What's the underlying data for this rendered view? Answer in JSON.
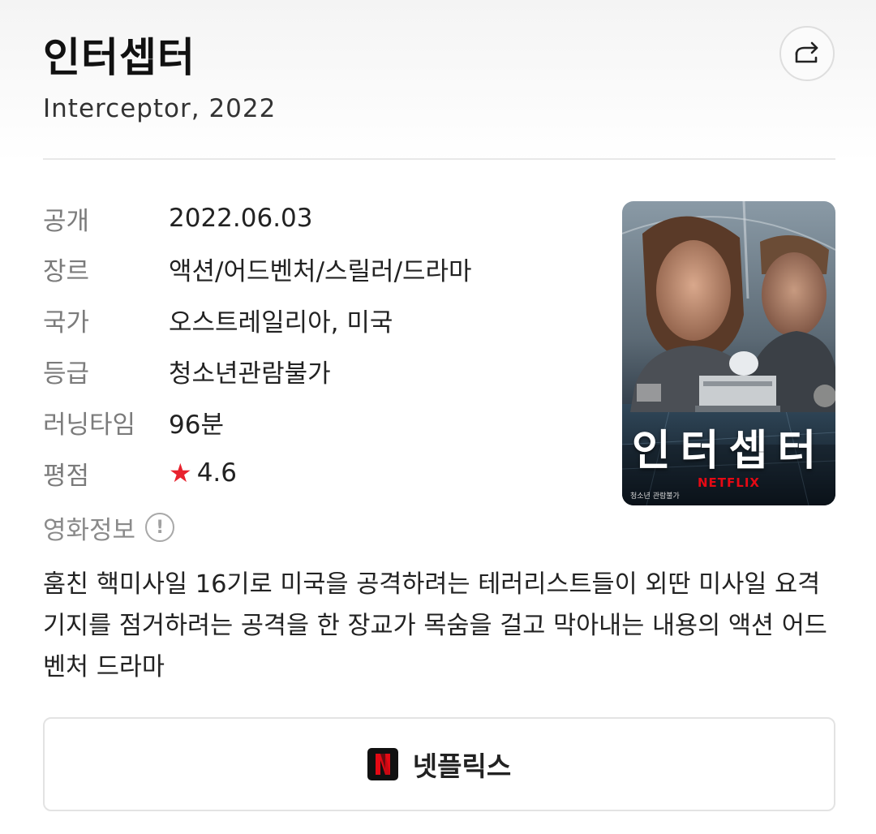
{
  "header": {
    "title": "인터셉터",
    "subtitle": "Interceptor, 2022",
    "share_icon": "share-icon"
  },
  "info": [
    {
      "label": "공개",
      "value": "2022.06.03"
    },
    {
      "label": "장르",
      "value": "액션/어드벤처/스릴러/드라마"
    },
    {
      "label": "국가",
      "value": "오스트레일리아, 미국"
    },
    {
      "label": "등급",
      "value": "청소년관람불가"
    },
    {
      "label": "러닝타임",
      "value": "96분"
    },
    {
      "label": "평점",
      "value": "4.6",
      "icon": "star-icon"
    }
  ],
  "movie_info": {
    "label": "영화정보",
    "icon_glyph": "!"
  },
  "synopsis": "훔친 핵미사일 16기로 미국을 공격하려는 테러리스트들이 외딴 미사일 요격기지를 점거하려는 공격을 한 장교가 목숨을 걸고 막아내는 내용의 액션 어드벤처 드라마",
  "poster": {
    "title": "인터셉터",
    "brand": "NETFLIX",
    "rating_text": "청소년 관람불가"
  },
  "watch_button": {
    "label": "넷플릭스",
    "logo_letter": "N"
  },
  "colors": {
    "star": "#e8222e",
    "netflix_red": "#e50914"
  }
}
